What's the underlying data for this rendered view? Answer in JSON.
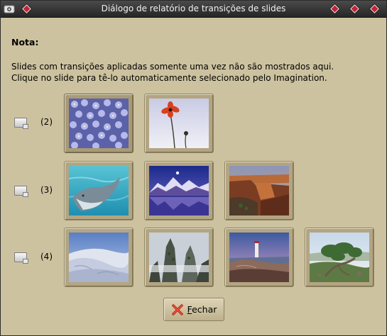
{
  "window": {
    "title": "Diálogo de relatório de transições de slides"
  },
  "note": {
    "heading": "Nota:",
    "line1": "Slides com transições aplicadas somente uma vez não são mostrados aqui.",
    "line2": "Clique no slide para tê-lo automaticamente selecionado pelo Imagination."
  },
  "rows": [
    {
      "count_label": "(2)",
      "icon": "transition-icon",
      "slides": [
        "blue-flowers",
        "red-poppy-sky"
      ]
    },
    {
      "count_label": "(3)",
      "icon": "transition-icon",
      "slides": [
        "dolphin",
        "mountain-lake-night",
        "canyon-sunset"
      ]
    },
    {
      "count_label": "(4)",
      "icon": "transition-icon",
      "slides": [
        "sand-dunes",
        "misty-peaks",
        "lighthouse-coast",
        "windswept-tree"
      ]
    }
  ],
  "close_button": {
    "label_mnemonic": "F",
    "label_rest": "echar",
    "icon": "close-x-icon"
  },
  "colors": {
    "dialog_bg": "#cdc2a0",
    "titlebar": "#262626",
    "title_buttons": "#c0253a"
  }
}
